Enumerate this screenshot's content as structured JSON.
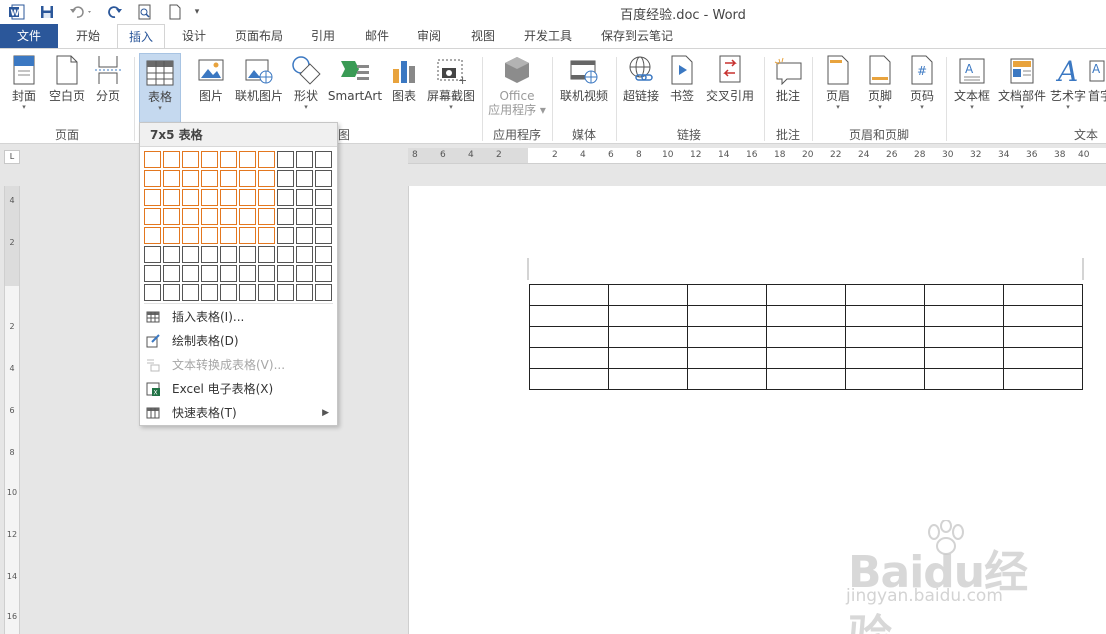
{
  "titlebar": {
    "doc_title": "百度经验.doc - Word",
    "quick_access": [
      "word-icon",
      "save-icon",
      "undo-icon",
      "redo-icon",
      "print-preview-icon",
      "new-doc-icon",
      "customize-qat-icon"
    ]
  },
  "tabs": {
    "file": "文件",
    "home": "开始",
    "insert": "插入",
    "design": "设计",
    "layout": "页面布局",
    "references": "引用",
    "mailings": "邮件",
    "review": "审阅",
    "view": "视图",
    "developer": "开发工具",
    "cloud": "保存到云笔记"
  },
  "ribbon": {
    "cover": "封面",
    "blank_page": "空白页",
    "page_break": "分页",
    "table": "表格",
    "picture": "图片",
    "online_picture": "联机图片",
    "shapes": "形状",
    "smartart": "SmartArt",
    "chart": "图表",
    "screenshot": "屏幕截图",
    "office_apps_1": "Office",
    "office_apps_2": "应用程序",
    "online_video": "联机视频",
    "hyperlink": "超链接",
    "bookmark": "书签",
    "cross_ref": "交叉引用",
    "comment": "批注",
    "header": "页眉",
    "footer": "页脚",
    "page_number": "页码",
    "text_box": "文本框",
    "quick_parts": "文档部件",
    "wordart": "艺术字",
    "drop_cap": "首字",
    "groups": {
      "pages": "页面",
      "illustrations_tail": "图",
      "apps": "应用程序",
      "media": "媒体",
      "links": "链接",
      "comments": "批注",
      "header_footer": "页眉和页脚",
      "text": "文本"
    }
  },
  "ruler": {
    "corner": "L",
    "h_numbers": [
      "8",
      "6",
      "4",
      "2",
      "2",
      "4",
      "6",
      "8",
      "10",
      "12",
      "14",
      "16",
      "18",
      "20",
      "22",
      "24",
      "26",
      "28",
      "30",
      "32",
      "34",
      "36",
      "38",
      "40"
    ],
    "v_numbers": [
      "4",
      "2",
      "2",
      "4",
      "6",
      "8",
      "10",
      "12",
      "14",
      "16"
    ]
  },
  "dropdown": {
    "header": "7x5 表格",
    "grid": {
      "cols": 10,
      "rows": 8,
      "selected_cols": 7,
      "selected_rows": 5
    },
    "items": {
      "insert_table": "插入表格(I)...",
      "draw_table": "绘制表格(D)",
      "text_to_table": "文本转换成表格(V)...",
      "excel_table": "Excel 电子表格(X)",
      "quick_tables": "快速表格(T)"
    }
  },
  "document_table": {
    "rows": 5,
    "cols": 7
  },
  "watermark": {
    "logo": "Baidu经验",
    "url": "jingyan.baidu.com"
  },
  "colors": {
    "accent": "#2b579a",
    "highlight": "#e3771f",
    "selected_button": "#c5d9ef"
  }
}
